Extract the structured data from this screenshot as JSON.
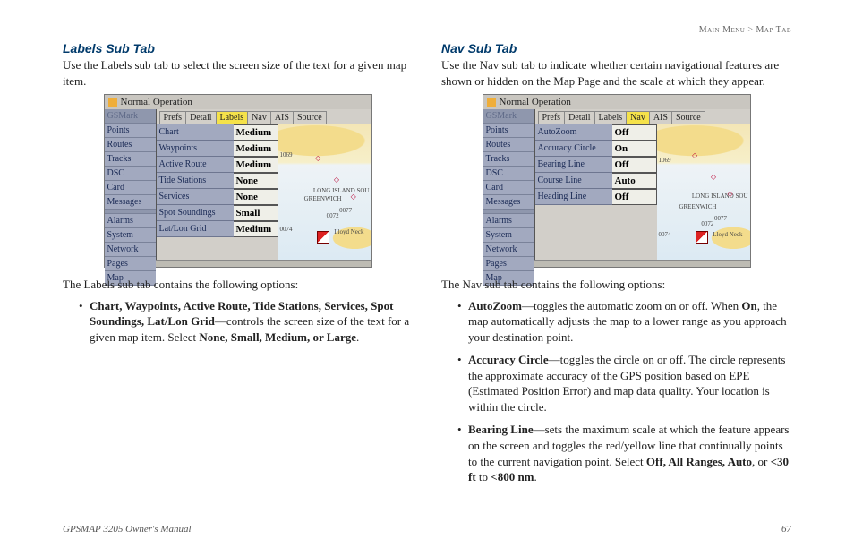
{
  "breadcrumb": {
    "section": "Main Menu",
    "sep": ">",
    "page": "Map Tab"
  },
  "left": {
    "heading": "Labels Sub Tab",
    "intro": "Use the Labels sub tab to select the screen size of the text for a given map item.",
    "caption": "The Labels sub tab contains the following options:",
    "bullet": {
      "bold_items": "Chart, Waypoints, Active Route, Tide Stations, Services, Spot Soundings, Lat/Lon Grid",
      "desc": "—controls the screen size of the text for a given map item. Select ",
      "bold_values": "None, Small, Medium, or Large",
      "end": "."
    },
    "fig": {
      "title": "Normal Operation",
      "side": [
        "GSMark",
        "Points",
        "Routes",
        "Tracks",
        "DSC",
        "Card",
        "Messages",
        "",
        "Alarms",
        "System",
        "Network",
        "Pages",
        "Map"
      ],
      "tabs": [
        "Prefs",
        "Detail",
        "Labels",
        "Nav",
        "AIS",
        "Source"
      ],
      "active_tab": 2,
      "rows": [
        {
          "lbl": "Chart",
          "val": "Medium"
        },
        {
          "lbl": "Waypoints",
          "val": "Medium"
        },
        {
          "lbl": "Active Route",
          "val": "Medium"
        },
        {
          "lbl": "Tide Stations",
          "val": "None"
        },
        {
          "lbl": "Services",
          "val": "None"
        },
        {
          "lbl": "Spot Soundings",
          "val": "Small"
        },
        {
          "lbl": "Lat/Lon Grid",
          "val": "Medium"
        }
      ],
      "map_labels": {
        "sound": "LONG ISLAND SOU",
        "greenwich": "GREENWICH",
        "lloyd": "Lloyd Neck",
        "n1": "0074",
        "n2": "0072",
        "n3": "0077",
        "n4": "1069"
      }
    }
  },
  "right": {
    "heading": "Nav Sub Tab",
    "intro": "Use the Nav sub tab to indicate whether certain navigational features are shown or hidden on the Map Page and the scale at which they appear.",
    "caption": "The Nav sub tab contains the following options:",
    "bullets": [
      {
        "bold": "AutoZoom",
        "rest": "—toggles the automatic zoom on or off. When ",
        "bold2": "On",
        "rest2": ", the map automatically adjusts the map to a lower range as you approach your destination point."
      },
      {
        "bold": "Accuracy Circle",
        "rest": "—toggles the circle on or off. The circle represents the approximate accuracy of the GPS position based on EPE (Estimated Position Error) and map data quality. Your location is within the circle."
      },
      {
        "bold": "Bearing Line",
        "rest": "—sets the maximum scale at which the feature appears on the screen and toggles the red/yellow line that continually points to the current navigation point. Select ",
        "bold2": "Off, All Ranges, Auto",
        "rest2": ", or ",
        "bold3": "<30 ft",
        "rest3": " to ",
        "bold4": "<800 nm",
        "rest4": "."
      }
    ],
    "fig": {
      "title": "Normal Operation",
      "side": [
        "GSMark",
        "Points",
        "Routes",
        "Tracks",
        "DSC",
        "Card",
        "Messages",
        "",
        "Alarms",
        "System",
        "Network",
        "Pages",
        "Map"
      ],
      "tabs": [
        "Prefs",
        "Detail",
        "Labels",
        "Nav",
        "AIS",
        "Source"
      ],
      "active_tab": 3,
      "rows": [
        {
          "lbl": "AutoZoom",
          "val": "Off"
        },
        {
          "lbl": "Accuracy Circle",
          "val": "On"
        },
        {
          "lbl": "Bearing Line",
          "val": "Off"
        },
        {
          "lbl": "Course Line",
          "val": "Auto"
        },
        {
          "lbl": "Heading Line",
          "val": "Off"
        }
      ],
      "map_labels": {
        "sound": "LONG ISLAND SOU",
        "greenwich": "GREENWICH",
        "lloyd": "Lloyd Neck",
        "n1": "0074",
        "n2": "0072",
        "n3": "0077",
        "n4": "1069"
      }
    }
  },
  "footer": {
    "manual": "GPSMAP 3205 Owner's Manual",
    "page": "67"
  }
}
